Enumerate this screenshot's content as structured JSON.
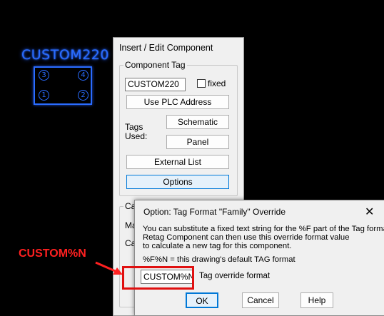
{
  "component": {
    "tag_display": "CUSTOM220",
    "pins": [
      "3",
      "4",
      "1",
      "2"
    ]
  },
  "main_dialog": {
    "title": "Insert / Edit Component",
    "component_tag_group": "Component Tag",
    "tag_value": "CUSTOM220",
    "fixed_label": "fixed",
    "use_plc_label": "Use PLC Address",
    "tags_used_label": "Tags\nUsed:",
    "schematic_label": "Schematic",
    "panel_label": "Panel",
    "external_list_label": "External List",
    "options_label": "Options",
    "cat_group_partial": "Ca",
    "partial_label_1": "Ma",
    "partial_label_2": "Ca"
  },
  "option_dialog": {
    "title": "Option: Tag Format \"Family\" Override",
    "close_glyph": "✕",
    "line1": "You can substitute a fixed text string for the %F part of the Tag format.",
    "line2": "Retag Component can then use this override format value",
    "line3": "to calculate a new tag for this component.",
    "default_note": "%F%N = this drawing's default TAG format",
    "override_value": "CUSTOM%N",
    "override_label": "Tag override format",
    "ok_label": "OK",
    "cancel_label": "Cancel",
    "help_label": "Help"
  },
  "annotation": {
    "label": "CUSTOM%N",
    "color": "#ff2020"
  },
  "colors": {
    "component_blue": "#2a6cff",
    "accent_blue": "#0078d7",
    "dialog_bg": "#f0f0f0",
    "annotation_red": "#e01010"
  }
}
